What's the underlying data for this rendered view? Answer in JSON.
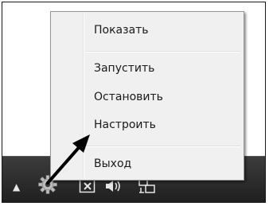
{
  "context_menu": {
    "items": [
      {
        "label": "Показать"
      },
      {
        "label": "Запустить"
      },
      {
        "label": "Остановить"
      },
      {
        "label": "Настроить"
      },
      {
        "label": "Выход"
      }
    ]
  },
  "taskbar": {
    "tray_icons": [
      {
        "icon": "show-hidden-icons-arrow"
      },
      {
        "icon": "gear-icon"
      },
      {
        "icon": "action-center-flag-icon"
      },
      {
        "icon": "speaker-volume-icon"
      },
      {
        "icon": "network-icon"
      }
    ]
  },
  "annotation": {
    "icon": "pointer-arrow"
  },
  "colors": {
    "menu_background": "#f0f0f0",
    "taskbar_background": "#2a2a2a",
    "arrow": "#000000"
  }
}
